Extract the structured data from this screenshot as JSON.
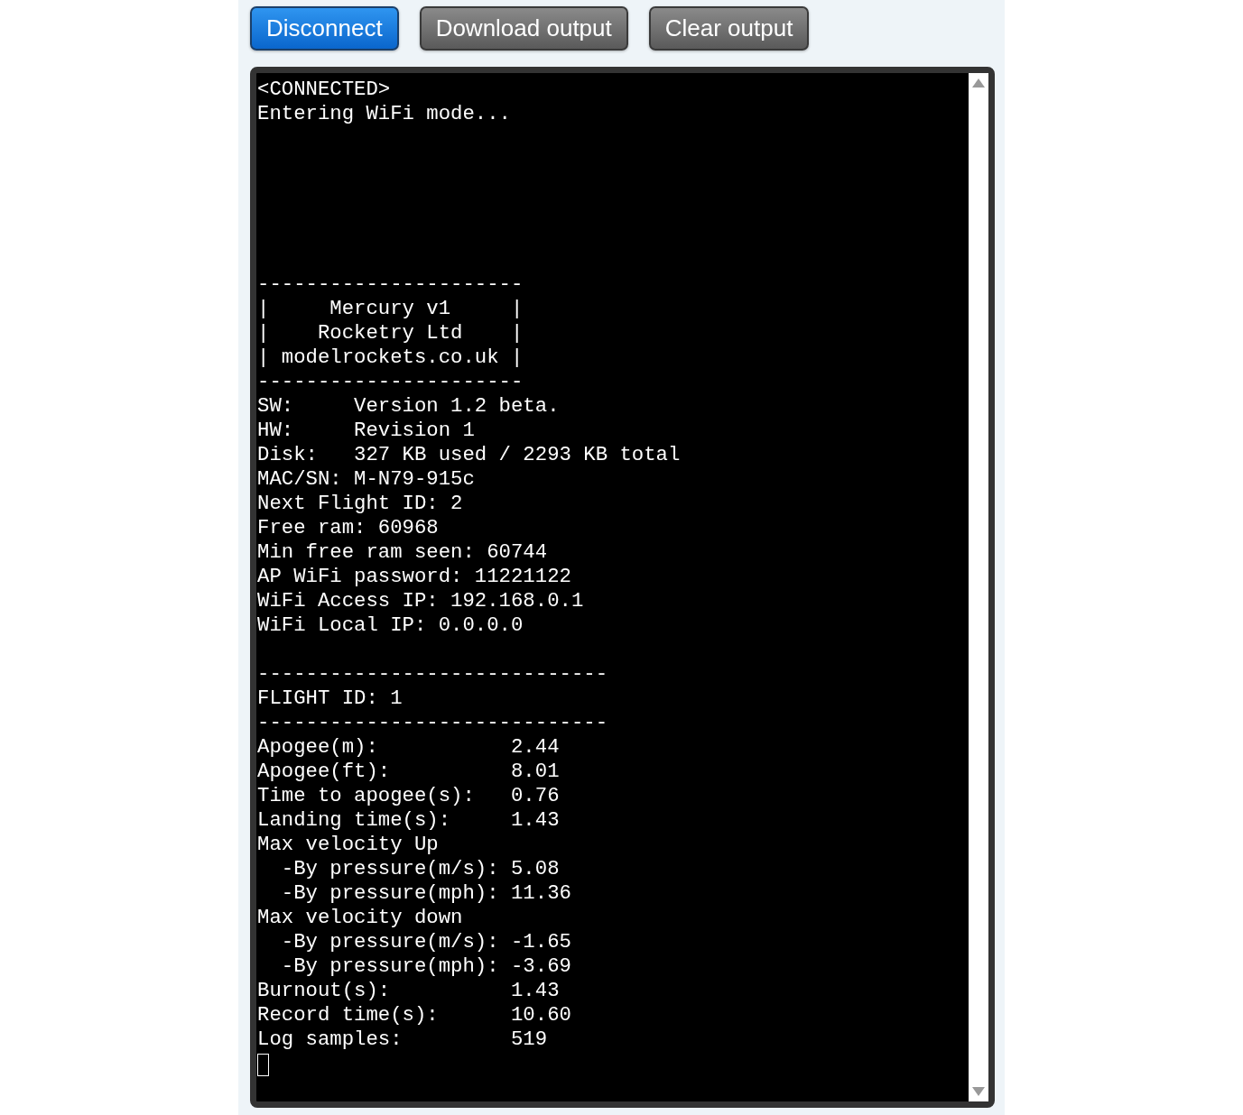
{
  "buttons": [
    {
      "label": "Disconnect",
      "kind": "primary"
    },
    {
      "label": "Download output",
      "kind": "secondary"
    },
    {
      "label": "Clear output",
      "kind": "secondary"
    }
  ],
  "terminal": {
    "lines": [
      {
        "kind": "text",
        "text": "<CONNECTED>"
      },
      {
        "kind": "text",
        "text": "Entering WiFi mode..."
      },
      {
        "kind": "blank"
      },
      {
        "kind": "blank"
      },
      {
        "kind": "blank"
      },
      {
        "kind": "blank"
      },
      {
        "kind": "blank"
      },
      {
        "kind": "blank"
      },
      {
        "kind": "text",
        "text": "----------------------"
      },
      {
        "kind": "text",
        "text": "|     Mercury v1     |"
      },
      {
        "kind": "text",
        "text": "|    Rocketry Ltd    |"
      },
      {
        "kind": "text",
        "text": "| modelrockets.co.uk |"
      },
      {
        "kind": "text",
        "text": "----------------------"
      },
      {
        "kind": "text",
        "text": "SW:     Version 1.2 beta."
      },
      {
        "kind": "text",
        "text": "HW:     Revision 1"
      },
      {
        "kind": "text",
        "text": "Disk:   327 KB used / 2293 KB total"
      },
      {
        "kind": "text",
        "text": "MAC/SN: M-N79-915c"
      },
      {
        "kind": "text",
        "text": "Next Flight ID: 2"
      },
      {
        "kind": "text",
        "text": "Free ram: 60968"
      },
      {
        "kind": "text",
        "text": "Min free ram seen: 60744"
      },
      {
        "kind": "text",
        "text": "AP WiFi password: 11221122"
      },
      {
        "kind": "text",
        "text": "WiFi Access IP: 192.168.0.1"
      },
      {
        "kind": "text",
        "text": "WiFi Local IP: 0.0.0.0"
      },
      {
        "kind": "blank"
      },
      {
        "kind": "text",
        "text": "-----------------------------"
      },
      {
        "kind": "text",
        "text": "FLIGHT ID: 1"
      },
      {
        "kind": "text",
        "text": "-----------------------------"
      },
      {
        "kind": "text",
        "text": "Apogee(m):           2.44"
      },
      {
        "kind": "text",
        "text": "Apogee(ft):          8.01"
      },
      {
        "kind": "text",
        "text": "Time to apogee(s):   0.76"
      },
      {
        "kind": "text",
        "text": "Landing time(s):     1.43"
      },
      {
        "kind": "text",
        "text": "Max velocity Up"
      },
      {
        "kind": "text",
        "text": "  -By pressure(m/s): 5.08"
      },
      {
        "kind": "text",
        "text": "  -By pressure(mph): 11.36"
      },
      {
        "kind": "text",
        "text": "Max velocity down"
      },
      {
        "kind": "text",
        "text": "  -By pressure(m/s): -1.65"
      },
      {
        "kind": "text",
        "text": "  -By pressure(mph): -3.69"
      },
      {
        "kind": "text",
        "text": "Burnout(s):          1.43"
      },
      {
        "kind": "text",
        "text": "Record time(s):      10.60"
      },
      {
        "kind": "text",
        "text": "Log samples:         519"
      },
      {
        "kind": "cursor"
      }
    ]
  }
}
